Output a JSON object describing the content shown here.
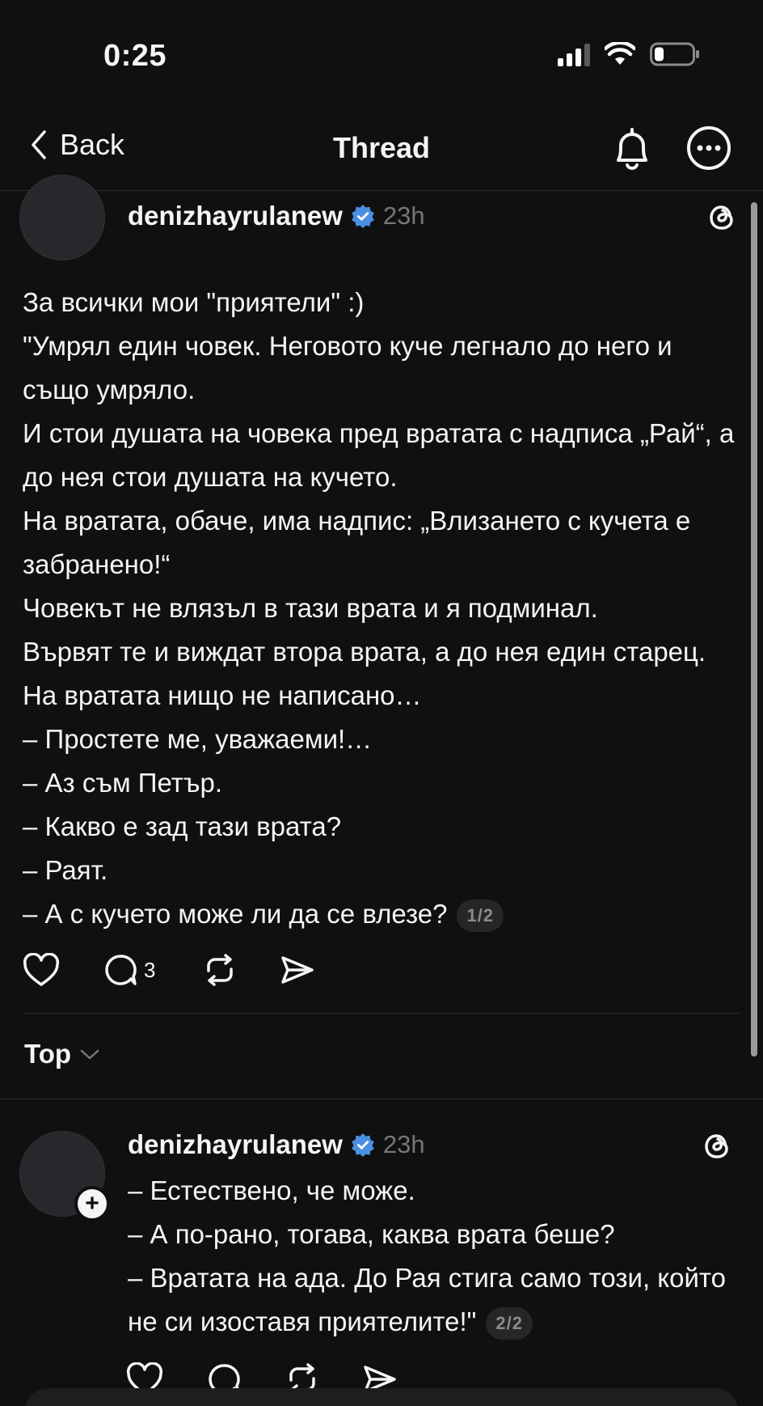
{
  "status_bar": {
    "time": "0:25"
  },
  "header": {
    "back_label": "Back",
    "title": "Thread"
  },
  "post": {
    "username": "denizhayrulanew",
    "time": "23h",
    "lines": [
      "За всички мои \"приятели\" :)",
      "\"Умрял един човек. Неговото куче легнало до него и също умряло.",
      "И стои душата на човека пред вратата с надписа „Рай“, а до нея стои душата на кучето.",
      "На вратата, обаче, има надпис: „Влизането с кучета е забранено!“",
      "Човекът не влязъл в тази врата и я подминал.",
      "Вървят те и виждат втора врата, а до нея един старец. На вратата нищо не написано…",
      "– Простете ме, уважаеми!…",
      "– Аз съм Петър.",
      "– Какво е зад тази врата?",
      "– Раят.",
      "– А с кучето може ли да се влезе?"
    ],
    "page_badge": "1/2",
    "reply_count": "3"
  },
  "sort": {
    "label": "Top"
  },
  "reply": {
    "username": "denizhayrulanew",
    "time": "23h",
    "lines": [
      "– Естествено, че може.",
      "– А по-рано, тогава, каква врата беше?",
      "– Вратата на ада. До Рая стига само този, който не си изоставя приятелите!\""
    ],
    "page_badge": "2/2"
  },
  "icons": {
    "back": "chevron-left-icon",
    "notifications": "bell-icon",
    "more": "more-icon",
    "verified": "verified-badge-icon",
    "threads": "threads-logo-icon",
    "like": "heart-icon",
    "reply": "comment-icon",
    "repost": "repost-icon",
    "share": "send-icon",
    "sort": "chevron-down-icon"
  },
  "colors": {
    "background": "#101010",
    "text": "#f3f5f7",
    "muted": "#777777",
    "verified": "#4a90e2"
  }
}
